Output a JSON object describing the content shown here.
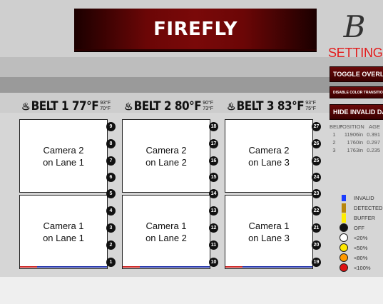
{
  "app": {
    "title": "FIREFLY",
    "logo_letter": "B",
    "settings_label": "SETTINGS"
  },
  "buttons": {
    "toggle_overlays": "TOGGLE OVERLAYS",
    "disable_color_transitions": "DISABLE COLOR TRANSITIONS",
    "hide_invalid_data": "HIDE INVALID DATA"
  },
  "belt_table": {
    "headers": [
      "BELT",
      "POSITION",
      "AGE"
    ],
    "rows": [
      {
        "belt": "1",
        "position": "11906in",
        "age": "0.391"
      },
      {
        "belt": "2",
        "position": "1760in",
        "age": "0.297"
      },
      {
        "belt": "3",
        "position": "1763in",
        "age": "0.235"
      }
    ]
  },
  "belts": [
    {
      "label": "BELT 1 77°F",
      "high": "93°F",
      "low": "70°F",
      "icon": "thermometer-icon"
    },
    {
      "label": "BELT 2 80°F",
      "high": "90°F",
      "low": "73°F",
      "icon": "thermometer-icon"
    },
    {
      "label": "BELT 3 83°F",
      "high": "93°F",
      "low": "75°F",
      "icon": "thermometer-icon"
    }
  ],
  "cameras": {
    "top": [
      {
        "line1": "Camera 2",
        "line2": "on Lane 1"
      },
      {
        "line1": "Camera 2",
        "line2": "on Lane 2"
      },
      {
        "line1": "Camera 2",
        "line2": "on Lane 3"
      }
    ],
    "bottom": [
      {
        "line1": "Camera 1",
        "line2": "on Lane 1"
      },
      {
        "line1": "Camera 1",
        "line2": "on Lane 2"
      },
      {
        "line1": "Camera 1",
        "line2": "on Lane 3"
      }
    ]
  },
  "slots": {
    "lane1": [
      "9",
      "8",
      "7",
      "6",
      "5",
      "4",
      "3",
      "2",
      "1"
    ],
    "lane2": [
      "18",
      "17",
      "16",
      "15",
      "14",
      "13",
      "12",
      "11",
      "10"
    ],
    "lane3": [
      "27",
      "26",
      "25",
      "24",
      "23",
      "22",
      "21",
      "20",
      "19"
    ]
  },
  "legend": [
    {
      "label": "INVALID",
      "color": "#1a3cff",
      "shape": "square-small"
    },
    {
      "label": "DETECTED",
      "color": "#b8860b",
      "shape": "square"
    },
    {
      "label": "BUFFER",
      "color": "#ffee00",
      "shape": "square"
    },
    {
      "label": "OFF",
      "color": "#111111",
      "shape": "circle"
    },
    {
      "label": "<20%",
      "color": "#ffffff",
      "shape": "circle"
    },
    {
      "label": "<50%",
      "color": "#ffe800",
      "shape": "circle"
    },
    {
      "label": "<80%",
      "color": "#ff9900",
      "shape": "circle"
    },
    {
      "label": "<100%",
      "color": "#dd1111",
      "shape": "circle"
    }
  ]
}
